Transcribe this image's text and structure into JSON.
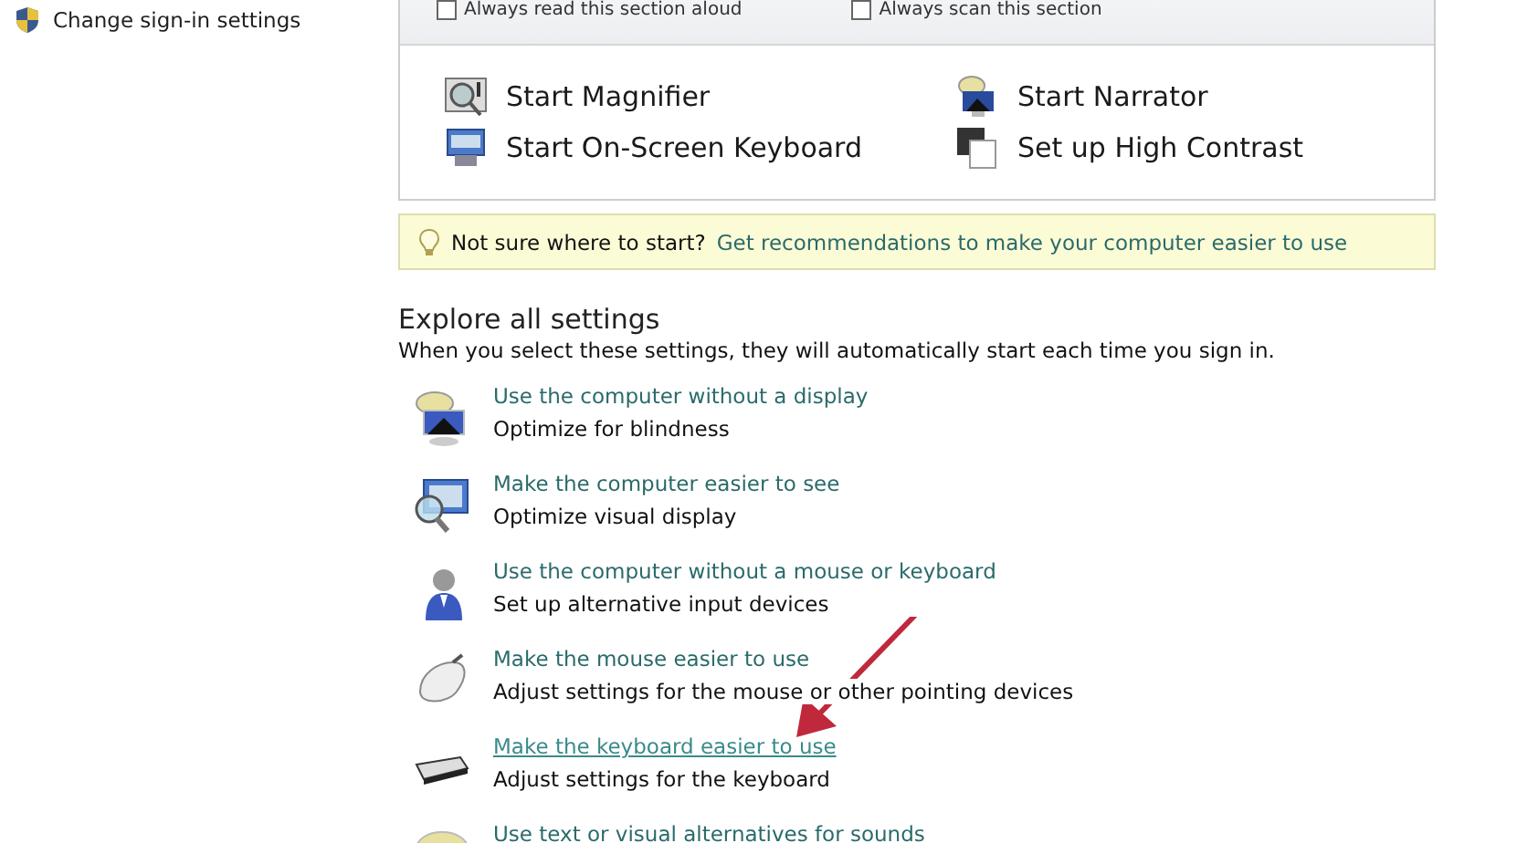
{
  "sidebar": {
    "items": [
      {
        "label": "Change sign-in settings"
      }
    ]
  },
  "quick_access": {
    "checkboxes": [
      {
        "label": "Always read this section aloud",
        "checked": false
      },
      {
        "label": "Always scan this section",
        "checked": false
      }
    ],
    "tools": [
      {
        "kind": "magnifier",
        "label": "Start Magnifier"
      },
      {
        "kind": "narrator",
        "label": "Start Narrator"
      },
      {
        "kind": "keyboard",
        "label": "Start On-Screen Keyboard"
      },
      {
        "kind": "contrast",
        "label": "Set up High Contrast"
      }
    ]
  },
  "tip": {
    "question": "Not sure where to start?",
    "link": "Get recommendations to make your computer easier to use"
  },
  "explore": {
    "heading": "Explore all settings",
    "description": "When you select these settings, they will automatically start each time you sign in.",
    "items": [
      {
        "kind": "display",
        "link": "Use the computer without a display",
        "description": "Optimize for blindness",
        "hovered": false
      },
      {
        "kind": "see",
        "link": "Make the computer easier to see",
        "description": "Optimize visual display",
        "hovered": false
      },
      {
        "kind": "person",
        "link": "Use the computer without a mouse or keyboard",
        "description": "Set up alternative input devices",
        "hovered": false
      },
      {
        "kind": "mouse",
        "link": "Make the mouse easier to use",
        "description": "Adjust settings for the mouse or other pointing devices",
        "hovered": false
      },
      {
        "kind": "keyboard",
        "link": "Make the keyboard easier to use",
        "description": "Adjust settings for the keyboard",
        "hovered": true
      },
      {
        "kind": "sound",
        "link": "Use text or visual alternatives for sounds",
        "hovered": false
      }
    ]
  }
}
